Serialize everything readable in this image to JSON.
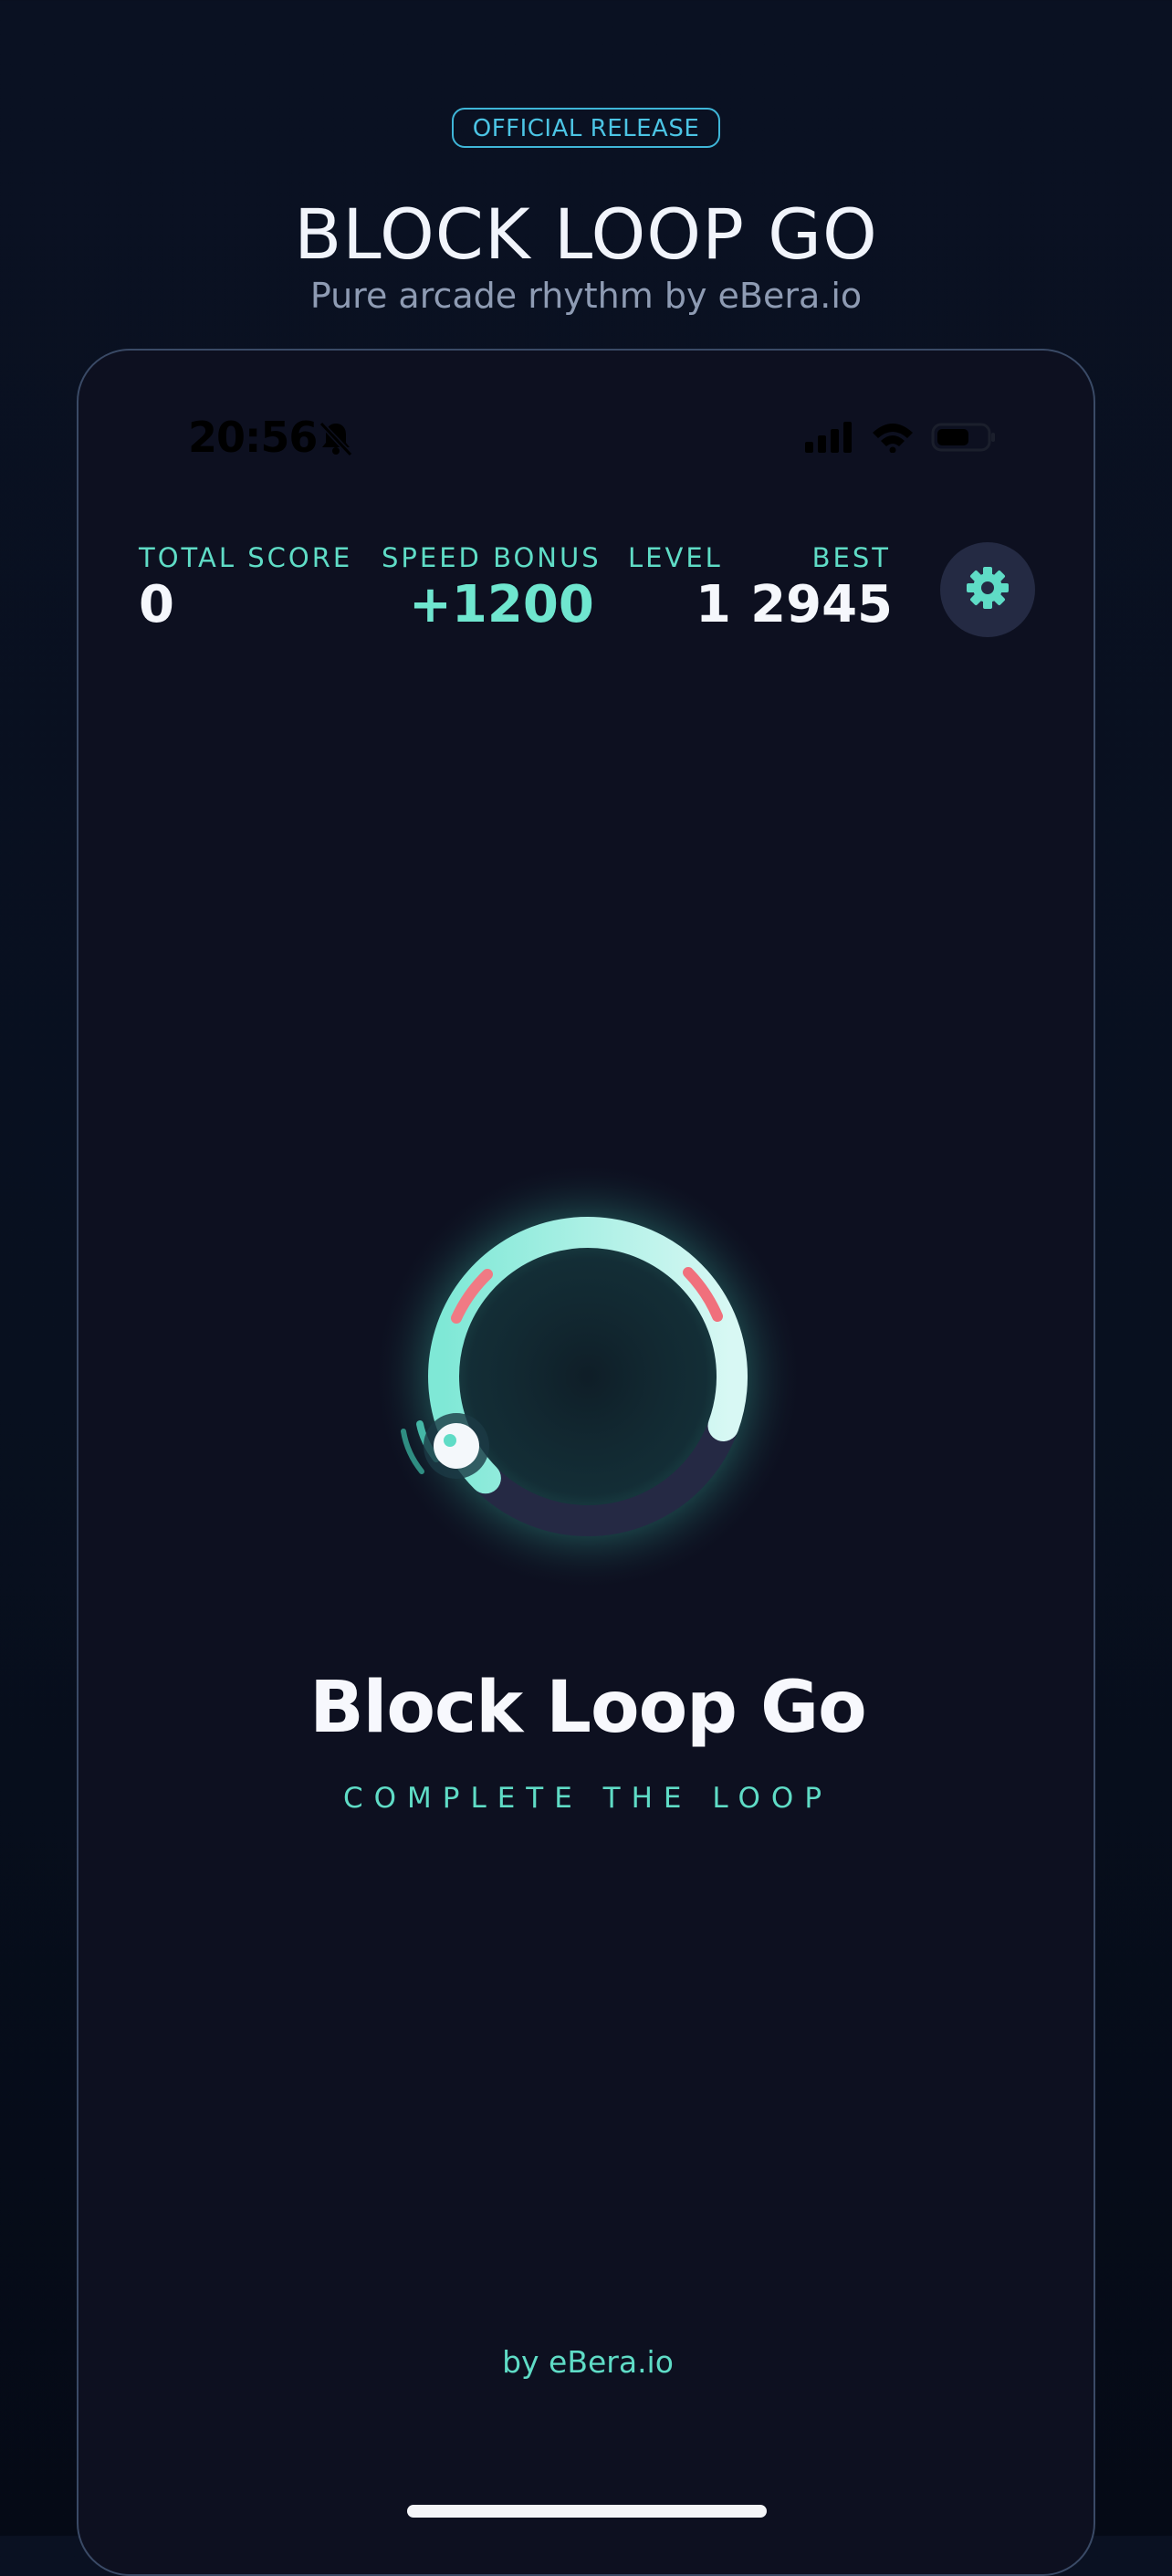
{
  "header": {
    "badge": "OFFICIAL RELEASE",
    "title": "BLOCK LOOP GO",
    "subtitle": "Pure arcade rhythm by eBera.io"
  },
  "status_bar": {
    "time": "20:56",
    "icons": [
      "bell-slash-icon",
      "signal-icon",
      "wifi-icon",
      "battery-icon"
    ]
  },
  "stats": {
    "total_score": {
      "label": "TOTAL SCORE",
      "value": "0"
    },
    "speed_bonus": {
      "label": "SPEED BONUS",
      "value": "+1200"
    },
    "level": {
      "label": "LEVEL",
      "value": "1"
    },
    "best": {
      "label": "BEST",
      "value": "2945"
    }
  },
  "settings": {
    "icon": "gear-icon"
  },
  "game": {
    "title": "Block Loop Go",
    "subtitle": "COMPLETE THE LOOP",
    "ring_progress": 0.68
  },
  "footer": {
    "credit": "by eBera.io"
  },
  "colors": {
    "accent": "#5fdcc6",
    "ring": "#8ef0dc",
    "obstacle": "#f0707c",
    "background": "#0d1020",
    "badge": "#3fb6d8"
  }
}
